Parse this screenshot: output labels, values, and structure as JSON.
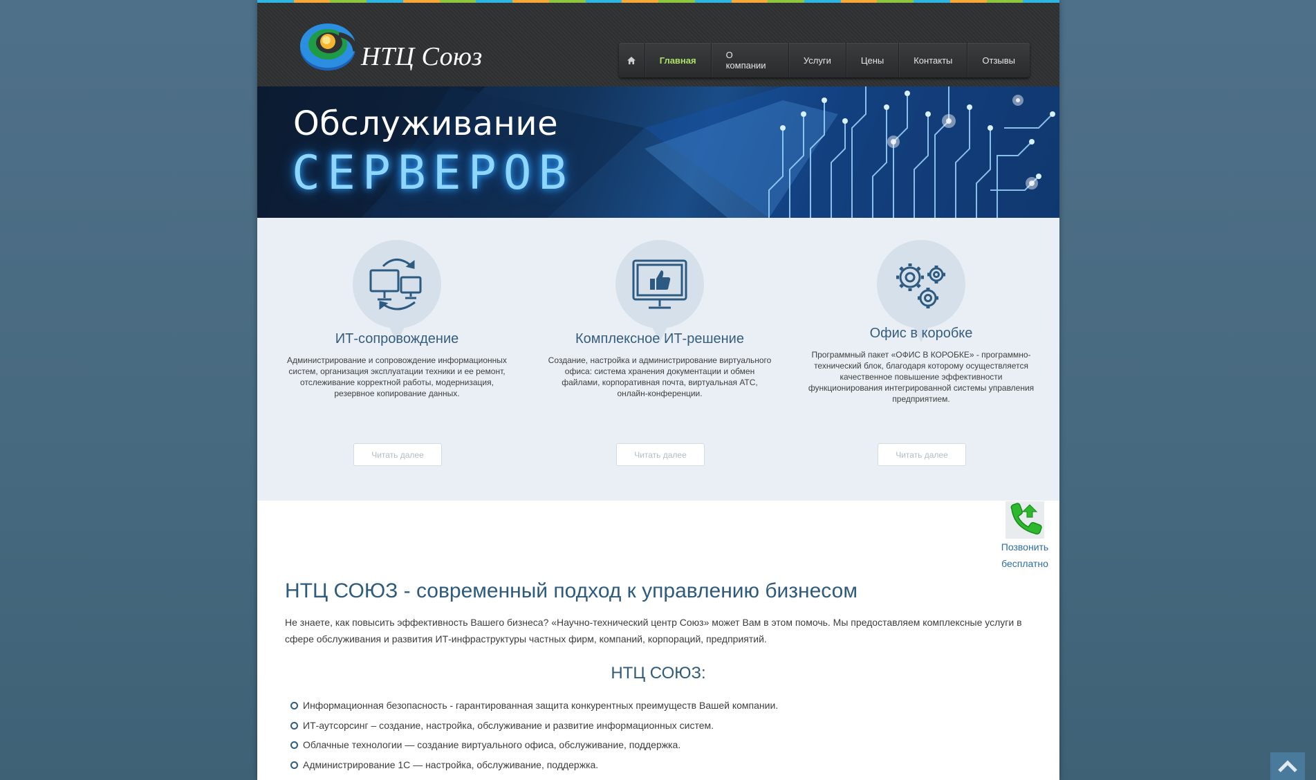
{
  "stripe_colors": [
    "#2fb6e0",
    "#f6a938",
    "#8dc63f",
    "#2fb6e0",
    "#f6a938",
    "#8dc63f",
    "#2fb6e0",
    "#f6a938",
    "#8dc63f",
    "#2fb6e0",
    "#f6a938",
    "#8dc63f",
    "#2fb6e0",
    "#f6a938",
    "#8dc63f",
    "#2fb6e0",
    "#f6a938",
    "#8dc63f",
    "#2fb6e0",
    "#f6a938",
    "#8dc63f",
    "#2fb6e0"
  ],
  "header": {
    "logo_text": "НТЦ Союз",
    "nav": {
      "home_icon": "home-icon",
      "items": [
        {
          "label": "Главная",
          "active": true
        },
        {
          "label": "О компании",
          "active": false
        },
        {
          "label": "Услуги",
          "active": false
        },
        {
          "label": "Цены",
          "active": false
        },
        {
          "label": "Контакты",
          "active": false
        },
        {
          "label": "Отзывы",
          "active": false
        }
      ]
    }
  },
  "banner": {
    "line1": "Обслуживание",
    "line2": "СЕРВЕРОВ"
  },
  "features": [
    {
      "icon": "computers-sync-icon",
      "title": "ИТ-сопровождение",
      "text": "Администрирование и сопровождение информационных систем, организация эксплуатации техники и ее ремонт, отслеживание корректной работы, модернизация, резервное копирование данных.",
      "button": "Читать далее"
    },
    {
      "icon": "monitor-thumbs-up-icon",
      "title": "Комплексное ИТ-решение",
      "text": "Создание, настройка и администрирование виртуального офиса: система хранения документации и обмен файлами, корпоративная почта, виртуальная АТС, онлайн-конференции.",
      "button": "Читать далее"
    },
    {
      "icon": "gears-icon",
      "title": "Офис в коробке",
      "text": "Программный пакет «ОФИС В КОРОБКЕ» - программно-технический блок, благодаря которому осуществляется качественное повышение эффективности функционирования интегрированной системы управления предприятием.",
      "button": "Читать далее"
    }
  ],
  "callback": {
    "icon": "phone-callback-icon",
    "line1": "Позвонить",
    "line2": "бесплатно"
  },
  "content": {
    "title": "НТЦ СОЮЗ - современный подход к управлению бизнесом",
    "intro": "Не знаете, как повысить эффективность Вашего бизнеса? «Научно-технический центр Союз» может Вам в этом помочь. Мы предоставляем комплексные услуги в сфере обслуживания и развития ИТ-инфраструктуры частных фирм, компаний, корпораций, предприятий.",
    "subtitle": "НТЦ СОЮЗ:",
    "benefits": [
      "Информационная безопасность - гарантированная защита конкурентных преимуществ Вашей компании.",
      "ИТ-аутсорсинг – создание, настройка, обслуживание и развитие информационных систем.",
      "Облачные технологии — создание виртуального офиса, обслуживание, поддержка.",
      "Администрирование 1С — настройка, обслуживание, поддержка."
    ]
  },
  "scroll_top_icon": "chevron-up-icon"
}
